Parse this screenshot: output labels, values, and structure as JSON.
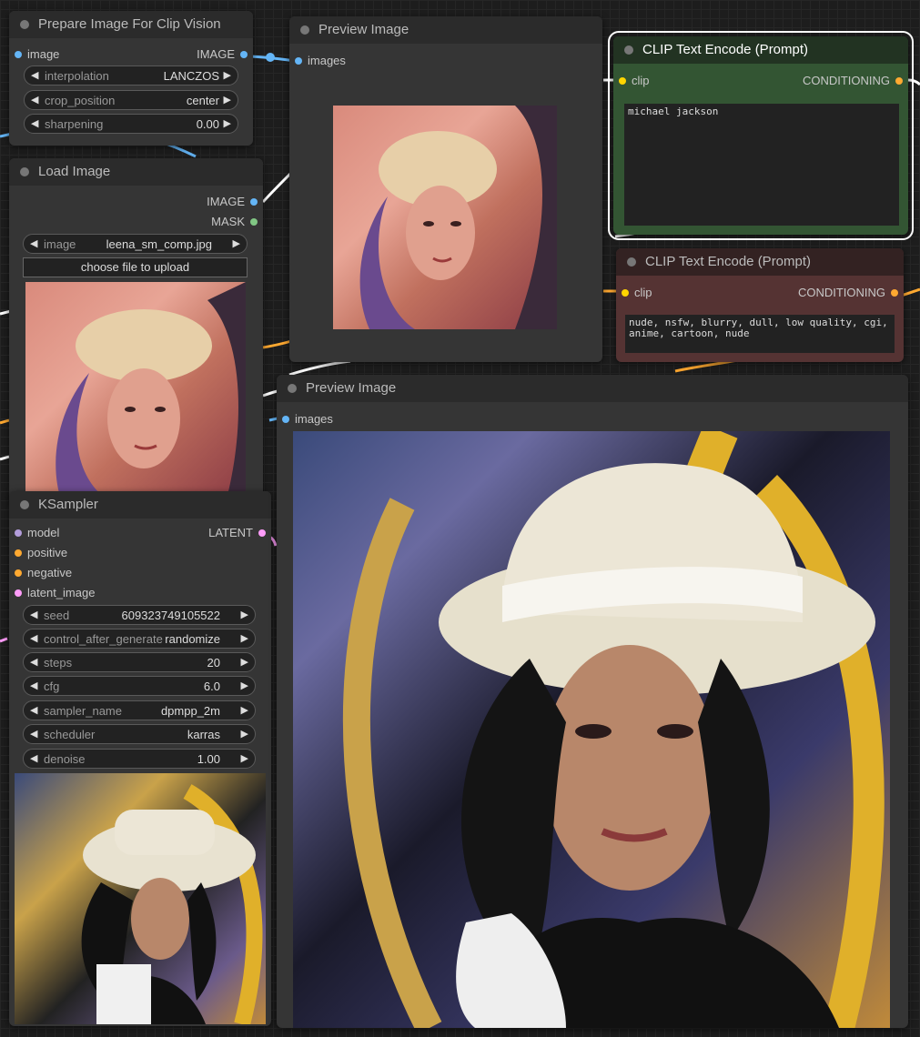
{
  "colors": {
    "pin_image": "#64b5f6",
    "pin_mask": "#81c784",
    "pin_clip": "#ffd500",
    "pin_conditioning": "#ffa931",
    "pin_model": "#b39ddb",
    "pin_latent": "#ff9cf9"
  },
  "prep_node": {
    "title": "Prepare Image For Clip Vision",
    "input_image": "image",
    "output_image": "IMAGE",
    "widgets": [
      {
        "name": "interpolation",
        "value": "LANCZOS"
      },
      {
        "name": "crop_position",
        "value": "center"
      },
      {
        "name": "sharpening",
        "value": "0.00"
      }
    ]
  },
  "preview1": {
    "title": "Preview Image",
    "input": "images"
  },
  "clip_pos": {
    "title": "CLIP Text Encode (Prompt)",
    "input": "clip",
    "output": "CONDITIONING",
    "text": "michael jackson"
  },
  "clip_neg": {
    "title": "CLIP Text Encode (Prompt)",
    "input": "clip",
    "output": "CONDITIONING",
    "text": "nude, nsfw, blurry, dull, low quality, cgi, anime, cartoon, nude"
  },
  "load_node": {
    "title": "Load Image",
    "out_image": "IMAGE",
    "out_mask": "MASK",
    "widget_name": "image",
    "widget_value": "leena_sm_comp.jpg",
    "upload_label": "choose file to upload"
  },
  "ksampler": {
    "title": "KSampler",
    "inputs": [
      "model",
      "positive",
      "negative",
      "latent_image"
    ],
    "output": "LATENT",
    "widgets": [
      {
        "name": "seed",
        "value": "609323749105522"
      },
      {
        "name": "control_after_generate",
        "value": "randomize"
      },
      {
        "name": "steps",
        "value": "20"
      },
      {
        "name": "cfg",
        "value": "6.0"
      },
      {
        "name": "sampler_name",
        "value": "dpmpp_2m"
      },
      {
        "name": "scheduler",
        "value": "karras"
      },
      {
        "name": "denoise",
        "value": "1.00"
      }
    ]
  },
  "preview2": {
    "title": "Preview Image",
    "input": "images"
  }
}
